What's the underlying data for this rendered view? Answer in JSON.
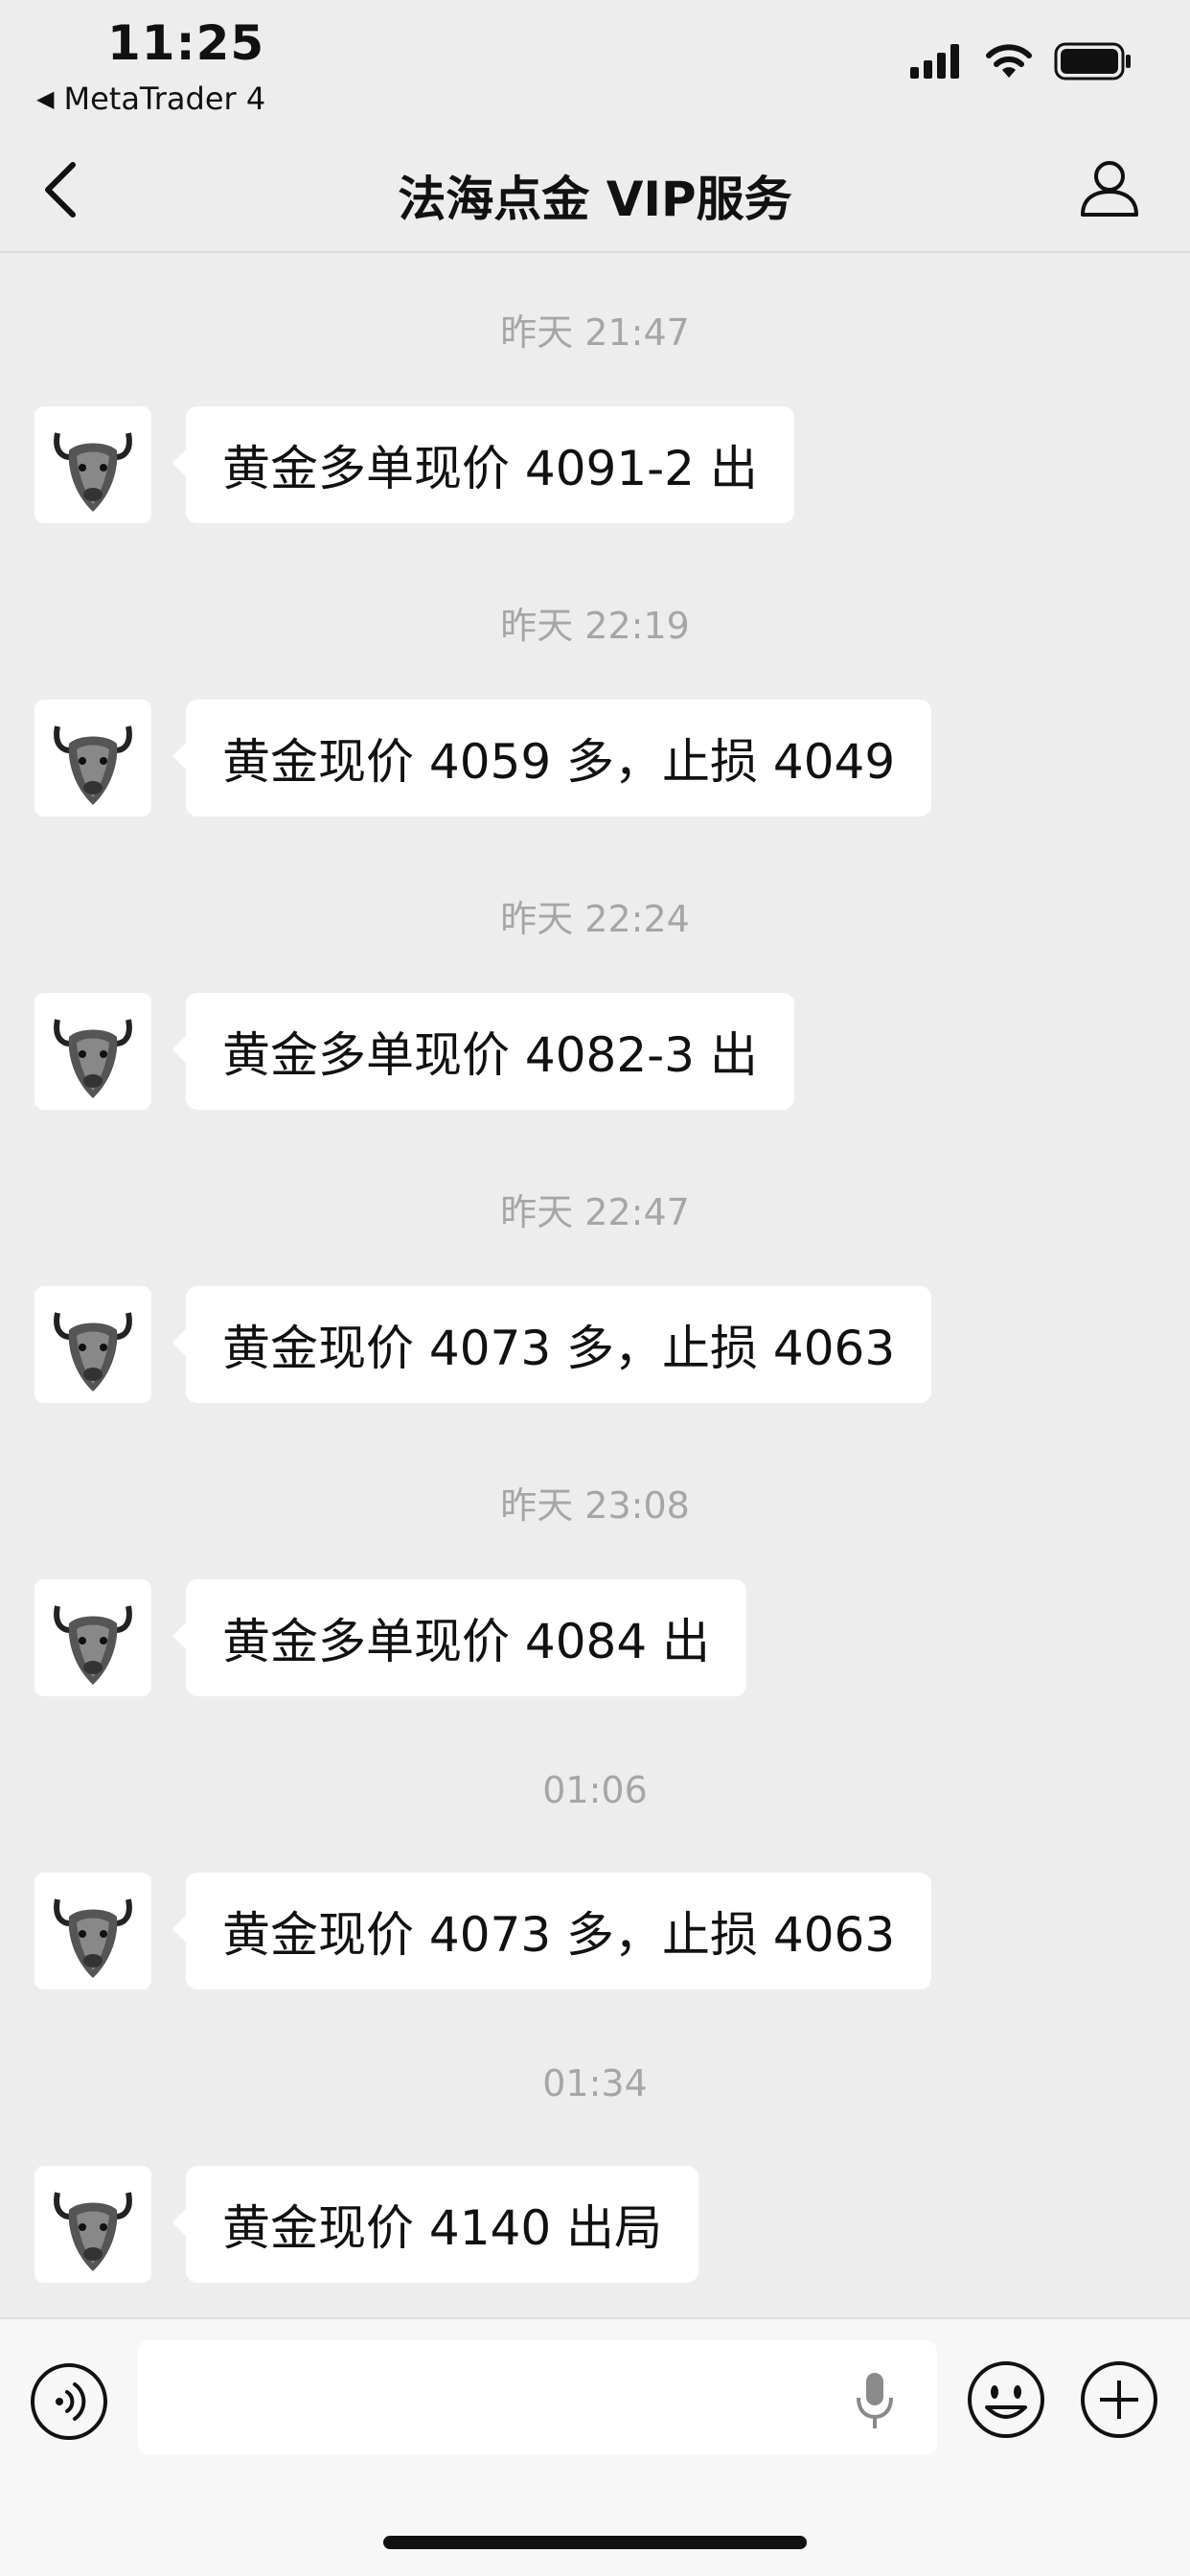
{
  "status_bar": {
    "time": "11:25",
    "back_app_label": "MetaTrader 4"
  },
  "nav": {
    "title": "法海点金 VIP服务"
  },
  "messages": [
    {
      "timestamp": "昨天 21:47",
      "text": "黄金多单现价 4091-2 出"
    },
    {
      "timestamp": "昨天 22:19",
      "text": "黄金现价 4059 多，止损 4049"
    },
    {
      "timestamp": "昨天 22:24",
      "text": "黄金多单现价 4082-3 出"
    },
    {
      "timestamp": "昨天 22:47",
      "text": "黄金现价 4073 多，止损 4063"
    },
    {
      "timestamp": "昨天 23:08",
      "text": "黄金多单现价 4084 出"
    },
    {
      "timestamp": "01:06",
      "text": "黄金现价 4073 多，止损 4063"
    },
    {
      "timestamp": "01:34",
      "text": "黄金现价 4140 出局"
    }
  ],
  "input": {
    "value": "",
    "placeholder": ""
  },
  "icons": {
    "back": "chevron-left-icon",
    "profile": "person-icon",
    "voice": "voice-icon",
    "mic": "microphone-icon",
    "emoji": "emoji-icon",
    "plus": "plus-icon",
    "avatar": "bull-head-avatar"
  },
  "colors": {
    "background": "#ededed",
    "bubble": "#ffffff",
    "timestamp": "#a6a6a6",
    "input_bar": "#f7f7f7"
  }
}
